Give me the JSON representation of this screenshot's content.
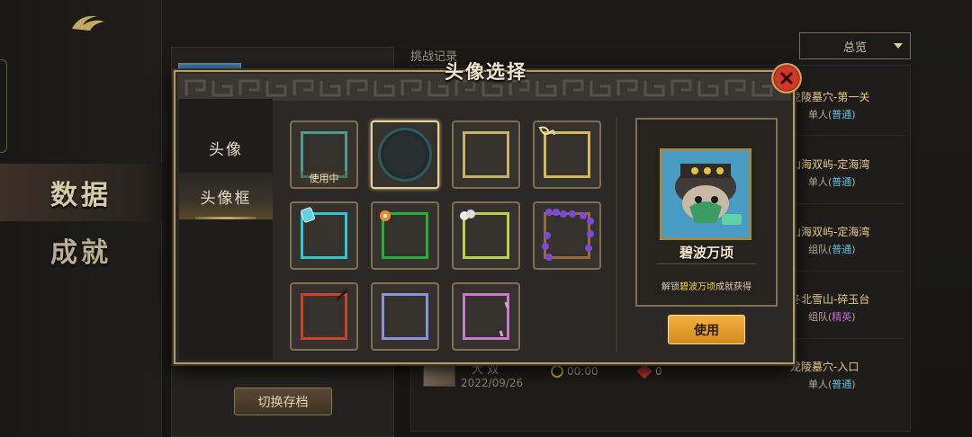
{
  "sidebar": {
    "tabs": [
      {
        "label": "数据",
        "active": true
      },
      {
        "label": "成就",
        "active": false
      }
    ]
  },
  "profile": {
    "switch_save_label": "切换存档"
  },
  "records": {
    "title": "挑战记录",
    "filter_value": "总览",
    "rows": [
      {
        "stage": "龙陵墓穴-第一关",
        "mode_prefix": "单人(",
        "difficulty": "普通",
        "mode_suffix": ")"
      },
      {
        "stage": "山海双屿-定海湾",
        "mode_prefix": "单人(",
        "difficulty": "普通",
        "mode_suffix": ")"
      },
      {
        "stage": "山海双屿-定海湾",
        "mode_prefix": "组队(",
        "difficulty": "普通",
        "mode_suffix": ")"
      },
      {
        "stage": "冬北雪山-碎玉台",
        "mode_prefix": "组队(",
        "difficulty": "精英",
        "mode_suffix": ")"
      },
      {
        "stage": "龙陵墓穴-入口",
        "mode_prefix": "单人(",
        "difficulty": "普通",
        "mode_suffix": ")"
      }
    ],
    "last_entry": {
      "name": "大 双",
      "date": "2022/09/26",
      "time": "00:00",
      "kills": "0"
    }
  },
  "modal": {
    "title": "头像选择",
    "tabs": [
      {
        "label": "头像",
        "active": false
      },
      {
        "label": "头像框",
        "active": true
      }
    ],
    "in_use_label": "使用中",
    "frames": [
      {
        "color": "#4e9a8c",
        "in_use": true,
        "selected": false
      },
      {
        "color": "#2f5a5c",
        "in_use": false,
        "selected": true
      },
      {
        "color": "#c9b36a",
        "in_use": false,
        "selected": false
      },
      {
        "color": "#d7b85a",
        "in_use": false,
        "selected": false
      },
      {
        "color": "#2fc6d0",
        "in_use": false,
        "selected": false
      },
      {
        "color": "#25b03a",
        "in_use": false,
        "selected": false
      },
      {
        "color": "#b9d24a",
        "in_use": false,
        "selected": false
      },
      {
        "color": "#9a6a3a",
        "in_use": false,
        "selected": false
      },
      {
        "color": "#c8432e",
        "in_use": false,
        "selected": false
      },
      {
        "color": "#8a93d6",
        "in_use": false,
        "selected": false
      },
      {
        "color": "#c77ac9",
        "in_use": false,
        "selected": false
      }
    ],
    "detail": {
      "name": "碧波万顷",
      "desc_prefix": "解锁",
      "desc_highlight": "碧波万顷",
      "desc_suffix": "成就获得",
      "use_label": "使用"
    }
  }
}
